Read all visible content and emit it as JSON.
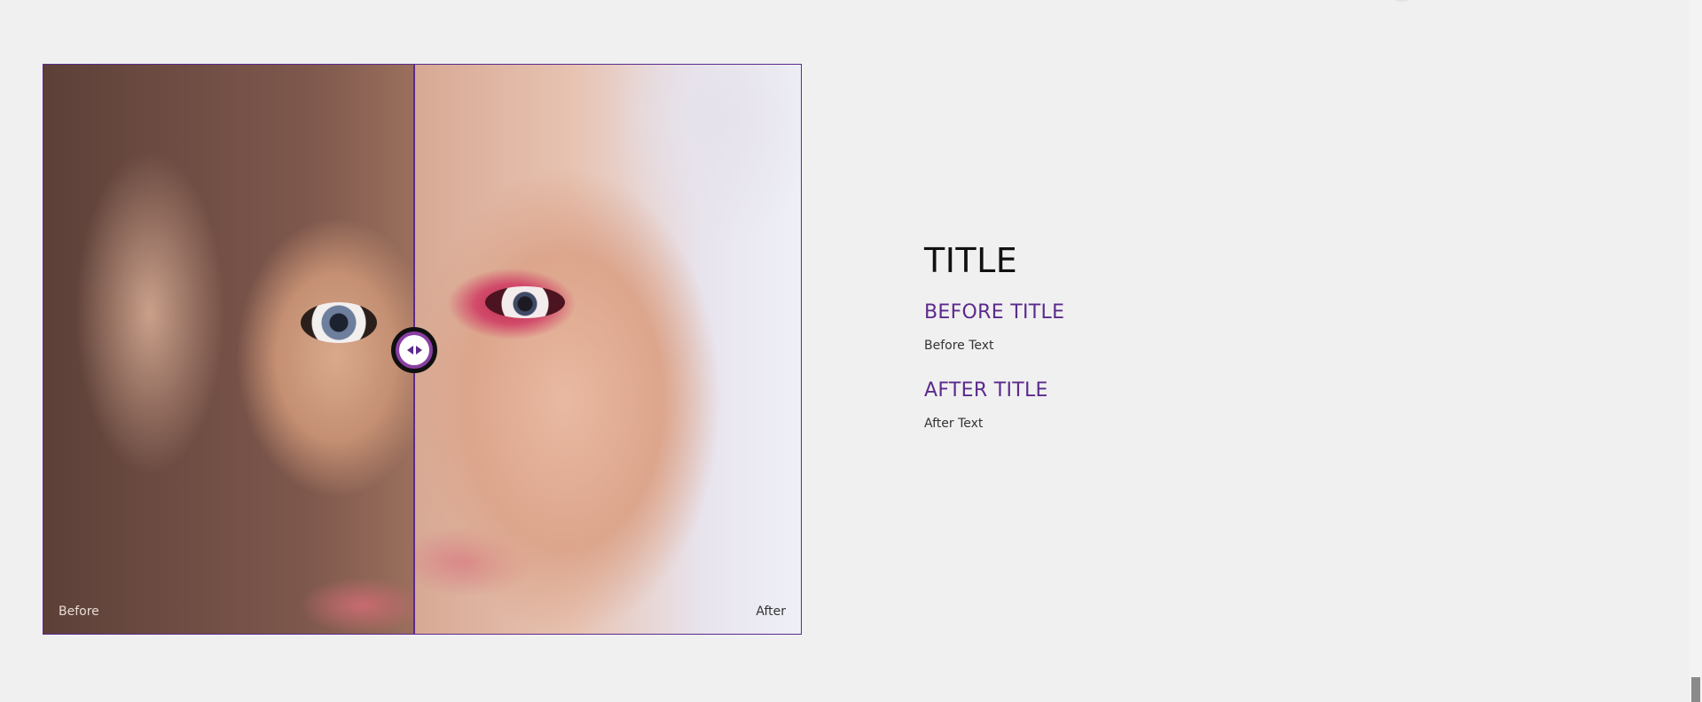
{
  "comparison": {
    "before_label": "Before",
    "after_label": "After",
    "slider_position_percent": 48.8
  },
  "content": {
    "title": "TITLE",
    "before_title": "BEFORE TITLE",
    "before_text": "Before Text",
    "after_title": "AFTER TITLE",
    "after_text": "After Text"
  },
  "colors": {
    "accent": "#5b2a8c",
    "background": "#f0f0f0",
    "heading": "#111111"
  },
  "icons": {
    "handle_left": "arrow-left-icon",
    "handle_right": "arrow-right-icon"
  }
}
